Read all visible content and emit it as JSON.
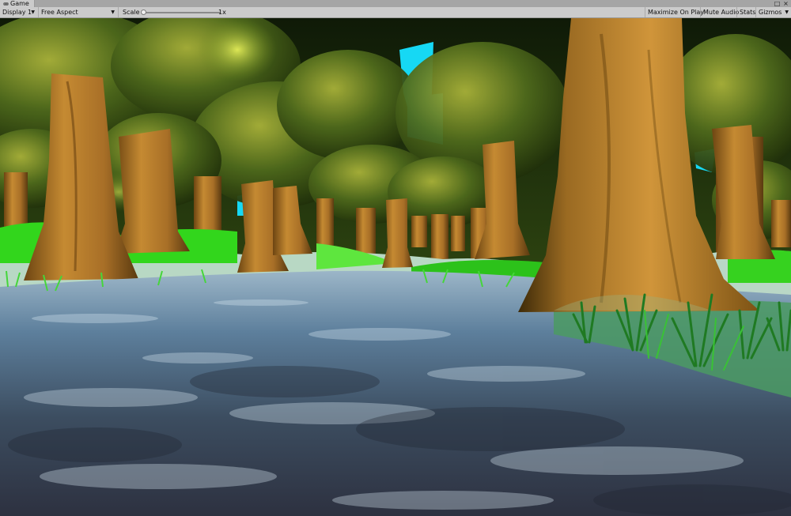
{
  "tab": {
    "title": "Game",
    "icon": "gamepad-icon"
  },
  "window_controls": {
    "maximize": "□",
    "close": "×"
  },
  "toolbar": {
    "display_label": "Display 1",
    "aspect_label": "Free Aspect",
    "scale_label": "Scale",
    "scale_value": "1x",
    "scale_level": 0.0,
    "maximize_label": "Maximize On Play",
    "mute_label": "Mute Audio",
    "stats_label": "Stats",
    "gizmos_label": "Gizmos"
  },
  "scene": {
    "sky_color": "#16d8f4",
    "water_color": "#5d7f9c",
    "grass_color": "#32d61c",
    "trunk_color": "#b5762a"
  }
}
